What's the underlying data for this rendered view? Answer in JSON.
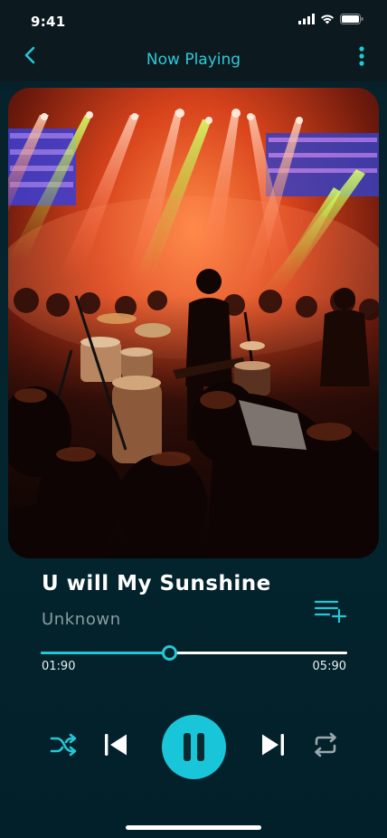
{
  "status_bar": {
    "time": "9:41"
  },
  "header": {
    "title": "Now Playing"
  },
  "track": {
    "title": "U will My Sunshine",
    "artist": "Unknown"
  },
  "playback": {
    "elapsed": "01:90",
    "duration": "05:90",
    "progress_fraction": 0.42
  },
  "colors": {
    "accent": "#19C6D9",
    "background": "#03222A",
    "muted_text": "#8B9CA2"
  },
  "icons": [
    "back-chevron-icon",
    "more-vertical-icon",
    "add-to-queue-icon",
    "shuffle-icon",
    "skip-previous-icon",
    "pause-icon",
    "skip-next-icon",
    "repeat-icon"
  ]
}
